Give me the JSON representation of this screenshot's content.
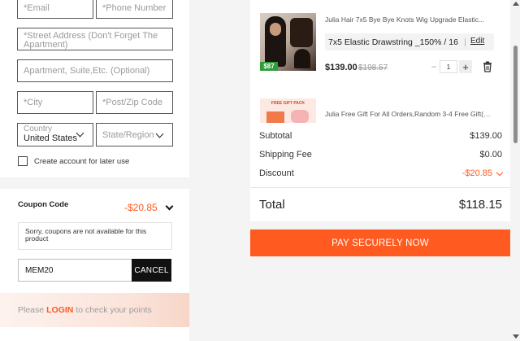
{
  "form": {
    "email_placeholder": "*Email",
    "phone_placeholder": "*Phone Number",
    "street_placeholder": "*Street Address (Don't Forget The Apartment)",
    "apartment_placeholder": "Apartment, Suite,Etc. (Optional)",
    "city_placeholder": "*City",
    "postal_placeholder": "*Post/Zip Code",
    "country_label": "Country",
    "country_value": "United States",
    "state_placeholder": "State/Region",
    "create_account_label": "Create account for later use"
  },
  "coupon": {
    "title": "Coupon Code",
    "discount": "-$20.85",
    "message": "Sorry, coupons are not available for this product",
    "code_value": "MEM20",
    "cancel_label": "CANCEL"
  },
  "login_prompt": {
    "before": "Please",
    "link": "LOGIN",
    "after": "to check your points"
  },
  "cart": {
    "items": [
      {
        "title": "Julia Hair 7x5 Bye Bye Knots Wig Upgrade Elastic...",
        "badge_price": "$87",
        "variant": "7x5 Elastic Drawstring _150% / 16",
        "edit_label": "Edit",
        "price": "$139.00",
        "original_price": "$198.57",
        "quantity": "1"
      },
      {
        "title": "Julia Free Gift For All Orders,Random 3-4 Free Gift(3...",
        "thumb_label": "FREE GIFT PACK"
      }
    ]
  },
  "summary": {
    "subtotal_label": "Subtotal",
    "subtotal_value": "$139.00",
    "shipping_label": "Shipping Fee",
    "shipping_value": "$0.00",
    "discount_label": "Discount",
    "discount_value": "-$20.85",
    "total_label": "Total",
    "total_value": "$118.15"
  },
  "pay_button_label": "PAY SECURELY NOW",
  "colors": {
    "accent": "#ff5a1f",
    "dark_button": "#111111",
    "badge_green": "#2e9e3a"
  },
  "icons": {
    "dropdown": "chevron-down-icon",
    "delete": "trash-icon",
    "quantity_decrease": "minus-icon",
    "quantity_increase": "plus-icon"
  }
}
